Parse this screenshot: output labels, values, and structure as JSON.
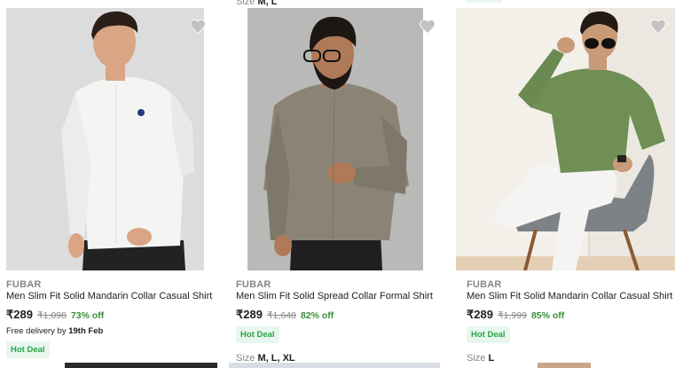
{
  "previous_row": {
    "col2_size_label": "Size",
    "col2_size_value": "M, L"
  },
  "products": [
    {
      "brand": "FUBAR",
      "title": "Men Slim Fit Solid Mandarin Collar Casual Shirt",
      "price": "₹289",
      "mrp": "₹1,098",
      "discount": "73% off",
      "delivery_prefix": "Free delivery by",
      "delivery_date": "19th Feb",
      "badge": "Hot Deal",
      "shirt_color": "#f4f4f2",
      "background_color": "#dcdcdc",
      "wishlist_icon": "heart-icon"
    },
    {
      "brand": "FUBAR",
      "title": "Men Slim Fit Solid Spread Collar Formal Shirt",
      "price": "₹289",
      "mrp": "₹1,648",
      "discount": "82% off",
      "badge": "Hot Deal",
      "size_label": "Size",
      "size_value": "M, L, XL",
      "shirt_color": "#8b8476",
      "background_color": "#b9b9b7",
      "wishlist_icon": "heart-icon"
    },
    {
      "brand": "FUBAR",
      "title": "Men Slim Fit Solid Mandarin Collar Casual Shirt",
      "price": "₹289",
      "mrp": "₹1,999",
      "discount": "85% off",
      "badge": "Hot Deal",
      "size_label": "Size",
      "size_value": "L",
      "shirt_color": "#6f8f55",
      "background_color": "#ece8e1",
      "wishlist_icon": "heart-icon"
    }
  ],
  "colors": {
    "discount_green": "#388e3c",
    "deal_badge_bg": "#e8f7ee",
    "deal_badge_text": "#26a541",
    "muted_text": "#878787"
  }
}
